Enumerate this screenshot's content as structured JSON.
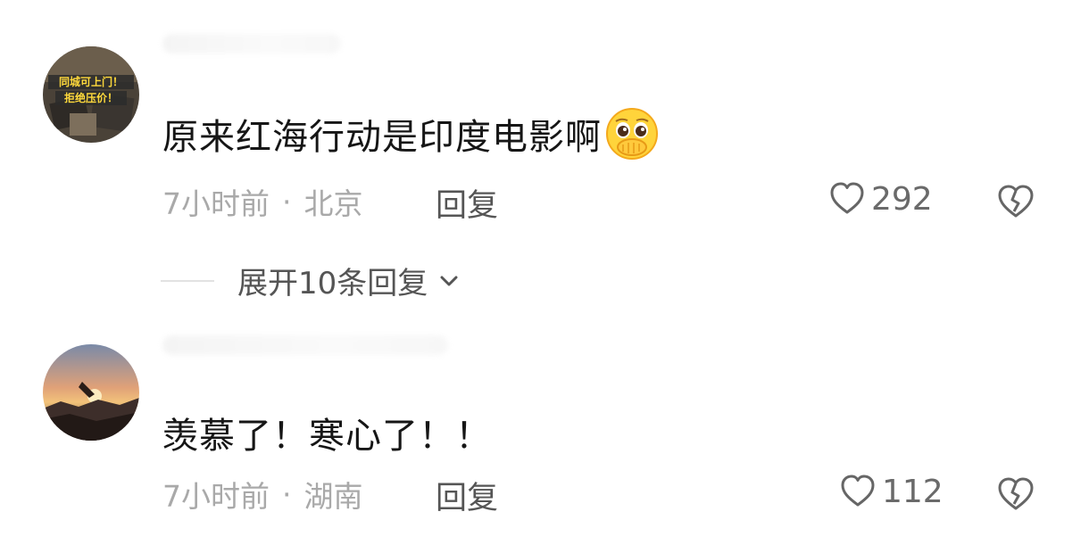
{
  "comments": [
    {
      "text": "原来红海行动是印度电影啊",
      "emoji": "pleading-face-hand-over-mouth-icon",
      "time": "7小时前",
      "separator": "·",
      "location": "北京",
      "reply_label": "回复",
      "likes": "292",
      "avatar_text_line1": "同城可上门！",
      "avatar_text_line2": "拒绝压价！"
    },
    {
      "text": "羡慕了！寒心了！！",
      "time": "7小时前",
      "separator": "·",
      "location": "湖南",
      "reply_label": "回复",
      "likes": "112"
    }
  ],
  "expand_replies": {
    "label": "展开10条回复"
  }
}
